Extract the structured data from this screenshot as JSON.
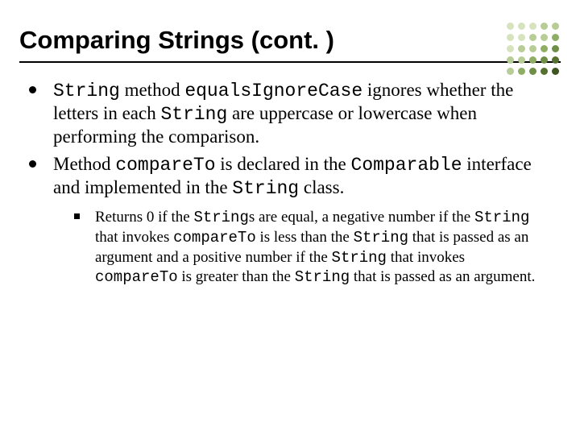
{
  "title": "Comparing Strings (cont. )",
  "dot_colors": [
    "#d6e3bd",
    "#d6e3bd",
    "#d6e3bd",
    "#b7cd95",
    "#b7cd95",
    "#d6e3bd",
    "#d6e3bd",
    "#b7cd95",
    "#b7cd95",
    "#8fae63",
    "#d6e3bd",
    "#b7cd95",
    "#b7cd95",
    "#8fae63",
    "#6f8f47",
    "#b7cd95",
    "#b7cd95",
    "#8fae63",
    "#6f8f47",
    "#55702f",
    "#b7cd95",
    "#8fae63",
    "#6f8f47",
    "#55702f",
    "#3f5521"
  ],
  "bullets": [
    {
      "seg": [
        {
          "t": "String",
          "m": true
        },
        {
          "t": " method "
        },
        {
          "t": "equalsIgnoreCase",
          "m": true
        },
        {
          "t": " ignores whether the letters in each "
        },
        {
          "t": "String",
          "m": true
        },
        {
          "t": " are uppercase or lowercase when performing the comparison."
        }
      ]
    },
    {
      "seg": [
        {
          "t": "Method "
        },
        {
          "t": "compareTo",
          "m": true
        },
        {
          "t": " is declared in the "
        },
        {
          "t": "Comparable",
          "m": true
        },
        {
          "t": " interface and implemented in the "
        },
        {
          "t": "String",
          "m": true
        },
        {
          "t": " class."
        }
      ],
      "sub": [
        {
          "seg": [
            {
              "t": "Returns 0 if the "
            },
            {
              "t": "String",
              "m": true
            },
            {
              "t": "s are equal, a negative number if the "
            },
            {
              "t": "String",
              "m": true
            },
            {
              "t": " that invokes "
            },
            {
              "t": "compareTo",
              "m": true
            },
            {
              "t": " is less than the "
            },
            {
              "t": "String",
              "m": true
            },
            {
              "t": " that is passed as an argument and a positive number if the "
            },
            {
              "t": "String",
              "m": true
            },
            {
              "t": " that invokes "
            },
            {
              "t": "compareTo",
              "m": true
            },
            {
              "t": " is greater than the "
            },
            {
              "t": "String",
              "m": true
            },
            {
              "t": " that is passed as an argument."
            }
          ]
        }
      ]
    }
  ]
}
